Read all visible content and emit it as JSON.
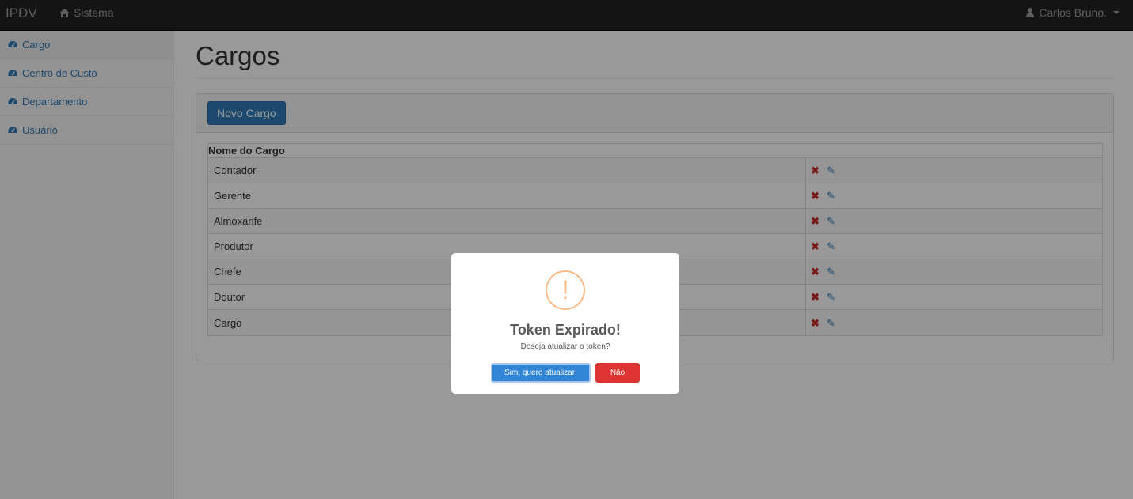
{
  "navbar": {
    "brand": "IPDV",
    "sistema_label": "Sistema",
    "user_label": "Carlos Bruno."
  },
  "sidebar": {
    "items": [
      {
        "label": "Cargo",
        "icon": "dashboard-icon"
      },
      {
        "label": "Centro de Custo",
        "icon": "dashboard-icon"
      },
      {
        "label": "Departamento",
        "icon": "dashboard-icon"
      },
      {
        "label": "Usuário",
        "icon": "dashboard-icon"
      }
    ]
  },
  "main": {
    "title": "Cargos",
    "new_button_label": "Novo Cargo",
    "table_header": "Nome do Cargo",
    "rows": [
      "Contador",
      "Gerente",
      "Almoxarife",
      "Produtor",
      "Chefe",
      "Doutor",
      "Cargo"
    ]
  },
  "modal": {
    "icon": "!",
    "title": "Token Expirado!",
    "text": "Deseja atualizar o token?",
    "confirm_label": "Sim, quero atualizar!",
    "cancel_label": "Não"
  },
  "colors": {
    "navbar": "#222222",
    "link": "#337ab7",
    "confirm": "#3085d6",
    "cancel": "#dd3333",
    "warning": "#f8bb86"
  }
}
